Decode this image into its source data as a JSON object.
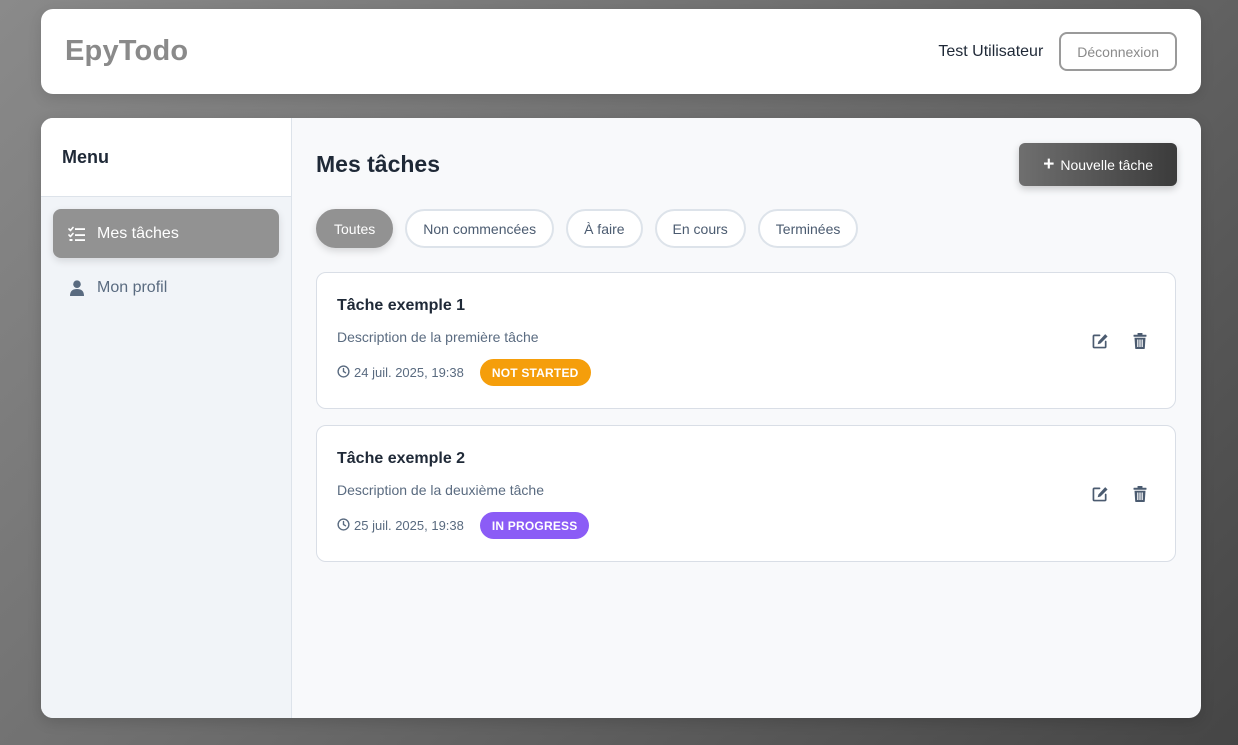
{
  "header": {
    "brand": "EpyTodo",
    "user_name": "Test Utilisateur",
    "logout_label": "Déconnexion"
  },
  "sidebar": {
    "title": "Menu",
    "items": [
      {
        "label": "Mes tâches",
        "icon": "tasks-list-icon",
        "active": true
      },
      {
        "label": "Mon profil",
        "icon": "user-icon",
        "active": false
      }
    ]
  },
  "main": {
    "title": "Mes tâches",
    "new_task_label": "Nouvelle tâche",
    "filters": [
      {
        "label": "Toutes",
        "active": true
      },
      {
        "label": "Non commencées",
        "active": false
      },
      {
        "label": "À faire",
        "active": false
      },
      {
        "label": "En cours",
        "active": false
      },
      {
        "label": "Terminées",
        "active": false
      }
    ],
    "tasks": [
      {
        "title": "Tâche exemple 1",
        "description": "Description de la première tâche",
        "date": "24 juil. 2025, 19:38",
        "status": "NOT STARTED",
        "status_color": "#f59e0b"
      },
      {
        "title": "Tâche exemple 2",
        "description": "Description de la deuxième tâche",
        "date": "25 juil. 2025, 19:38",
        "status": "IN PROGRESS",
        "status_color": "#8b5cf6"
      }
    ]
  },
  "colors": {
    "accent_gray": "#929292",
    "not_started": "#f59e0b",
    "in_progress": "#8b5cf6",
    "icon_slate": "#4b5b70"
  }
}
